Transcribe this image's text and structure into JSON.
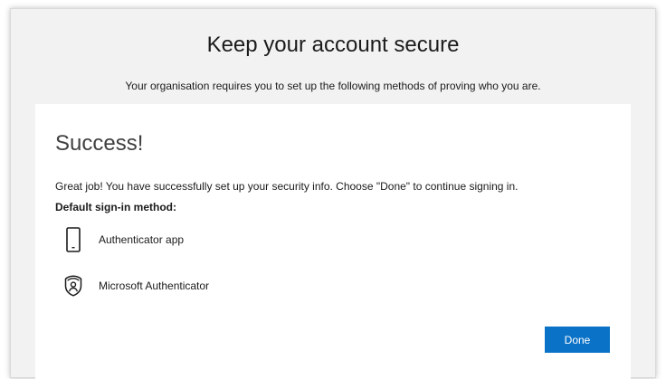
{
  "page": {
    "title": "Keep your account secure",
    "subtitle": "Your organisation requires you to set up the following methods of proving who you are."
  },
  "card": {
    "heading": "Success!",
    "message": "Great job! You have successfully set up your security info. Choose \"Done\" to continue signing in.",
    "default_method_label": "Default sign-in method:",
    "methods": [
      {
        "icon": "mobile-phone-icon",
        "label": "Authenticator app"
      },
      {
        "icon": "microsoft-authenticator-icon",
        "label": "Microsoft Authenticator"
      }
    ],
    "done_label": "Done"
  },
  "colors": {
    "accent": "#0a72c7",
    "background": "#f2f2f2",
    "card": "#ffffff"
  }
}
